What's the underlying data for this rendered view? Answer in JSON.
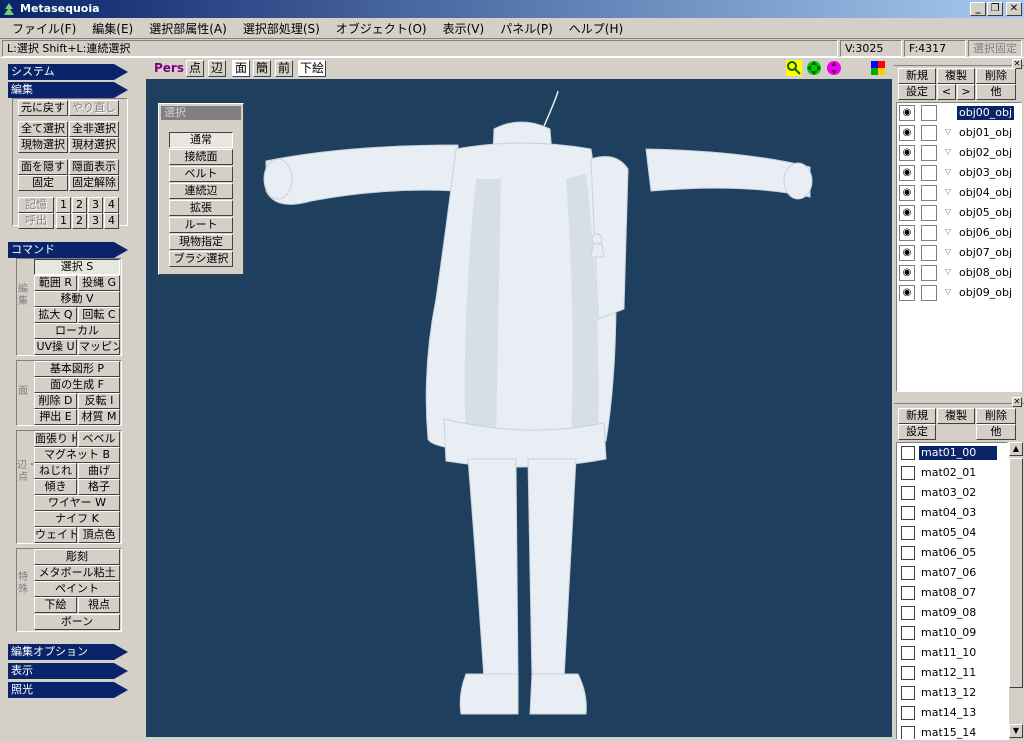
{
  "window": {
    "title": "Metasequoia",
    "btn_min": "_",
    "btn_max": "❐",
    "btn_close": "✕"
  },
  "menu": [
    "ファイル(F)",
    "編集(E)",
    "選択部属性(A)",
    "選択部処理(S)",
    "オブジェクト(O)",
    "表示(V)",
    "パネル(P)",
    "ヘルプ(H)"
  ],
  "status": {
    "hint": "L:選択  Shift+L:連続選択",
    "vertices": "V:3025",
    "faces": "F:4317",
    "fix_label": "選択固定"
  },
  "left": {
    "system": "システム",
    "edit": "編集",
    "undo": "元に戻す",
    "redo": "やり直し",
    "select_all": "全て選択",
    "deselect_all": "全非選択",
    "select_current_obj": "現物選択",
    "select_current_mat": "現材選択",
    "hide_face": "面を隠す",
    "show_hidden": "隠面表示",
    "fix": "固定",
    "unfix": "固定解除",
    "memory": "記憶",
    "recall": "呼出",
    "slots": [
      "1",
      "2",
      "3",
      "4"
    ],
    "command": "コマンド",
    "grp_edit": "編集",
    "grp_face": "面",
    "grp_edge": "辺・点",
    "grp_special": "特殊",
    "select": "選択 S",
    "range": "範囲 R",
    "lasso": "投縄 G",
    "move": "移動 V",
    "scale": "拡大 Q",
    "rotate": "回転 C",
    "local": "ローカル",
    "uv": "UV操 U",
    "mapping": "マッピング",
    "primitive": "基本図形 P",
    "face_gen": "面の生成 F",
    "delete": "削除 D",
    "flip": "反転 I",
    "extrude": "押出 E",
    "material": "材質 M",
    "stretch": "面張り H",
    "bevel": "ベベル",
    "magnet": "マグネット B",
    "twist": "ねじれ",
    "bend": "曲げ",
    "tilt": "傾き",
    "lattice": "格子",
    "wire": "ワイヤー W",
    "knife": "ナイフ K",
    "weight": "ウェイト",
    "vcolor": "頂点色",
    "sculpt": "彫刻",
    "metaball": "メタボール粘土",
    "paint": "ペイント",
    "underlay": "下絵",
    "viewpoint": "視点",
    "bone": "ボーン",
    "edit_option": "編集オプション",
    "display": "表示",
    "light": "照光"
  },
  "viewtool": {
    "persp": "Pers",
    "pt": "点",
    "edge": "辺",
    "face": "面",
    "simple": "簡",
    "front": "前",
    "underlay": "下絵"
  },
  "select_panel": {
    "title": "選択",
    "items": [
      "通常",
      "接続面",
      "ベルト",
      "連続辺",
      "拡張",
      "ルート",
      "現物指定",
      "ブラシ選択"
    ],
    "active": 0
  },
  "objects": {
    "new": "新規",
    "copy": "複製",
    "delete": "削除",
    "settings": "設定",
    "prev": "<",
    "next": ">",
    "other": "他",
    "items": [
      "obj00_obj",
      "obj01_obj",
      "obj02_obj",
      "obj03_obj",
      "obj04_obj",
      "obj05_obj",
      "obj06_obj",
      "obj07_obj",
      "obj08_obj",
      "obj09_obj"
    ],
    "selected": 0
  },
  "materials": {
    "new": "新規",
    "copy": "複製",
    "delete": "削除",
    "settings": "設定",
    "other": "他",
    "items": [
      "mat01_00",
      "mat02_01",
      "mat03_02",
      "mat04_03",
      "mat05_04",
      "mat06_05",
      "mat07_06",
      "mat08_07",
      "mat09_08",
      "mat10_09",
      "mat11_10",
      "mat12_11",
      "mat13_12",
      "mat14_13",
      "mat15_14"
    ],
    "selected": 0
  },
  "colors": {
    "viewport": "#1f3f5f",
    "title": "#0a246a",
    "face": "#d4d0c8"
  }
}
